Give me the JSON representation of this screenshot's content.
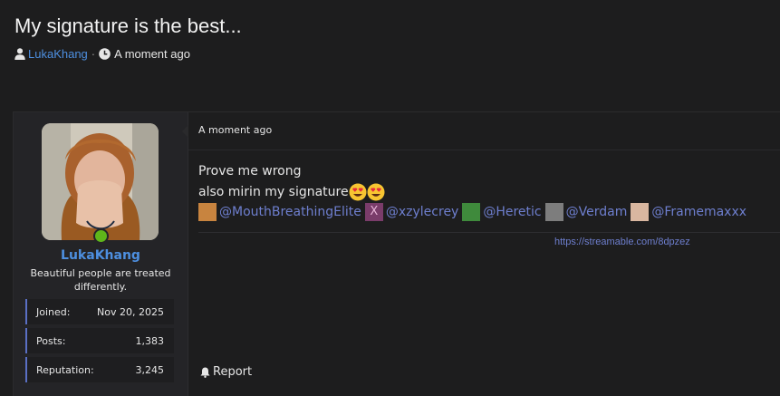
{
  "thread": {
    "title": "My signature is the best...",
    "author": "LukaKhang",
    "separator": "·",
    "time": "A moment ago"
  },
  "post": {
    "time": "A moment ago",
    "body_line1": "Prove me wrong",
    "body_line2": "also mirin my signature",
    "emojis": [
      "heart-eyes-emoji",
      "heart-eyes-emoji"
    ],
    "mentions": [
      {
        "name": "@MouthBreathingElite",
        "avatar_color": "#c8843f"
      },
      {
        "name": "@xzylecrey",
        "avatar_color": "#7a3c6a"
      },
      {
        "name": "@Heretic",
        "avatar_color": "#3f8a3c"
      },
      {
        "name": "@Verdam",
        "avatar_color": "#7d7d7d"
      },
      {
        "name": "@Framemaxxx",
        "avatar_color": "#d9b7a0"
      }
    ],
    "signature_link": "https://streamable.com/8dpzez",
    "report_label": "Report"
  },
  "sidebar": {
    "username": "LukaKhang",
    "user_title": "Beautiful people are treated differently.",
    "stats": [
      {
        "label": "Joined:",
        "value": "Nov 20, 2025"
      },
      {
        "label": "Posts:",
        "value": "1,383"
      },
      {
        "label": "Reputation:",
        "value": "3,245"
      }
    ]
  },
  "colors": {
    "background": "#1d1d1e",
    "sidebar": "#242427",
    "link_blue": "#4d8fe0",
    "mention": "#6e7fcf",
    "online": "#5fb61a",
    "stat_accent": "#5a6fc4"
  }
}
